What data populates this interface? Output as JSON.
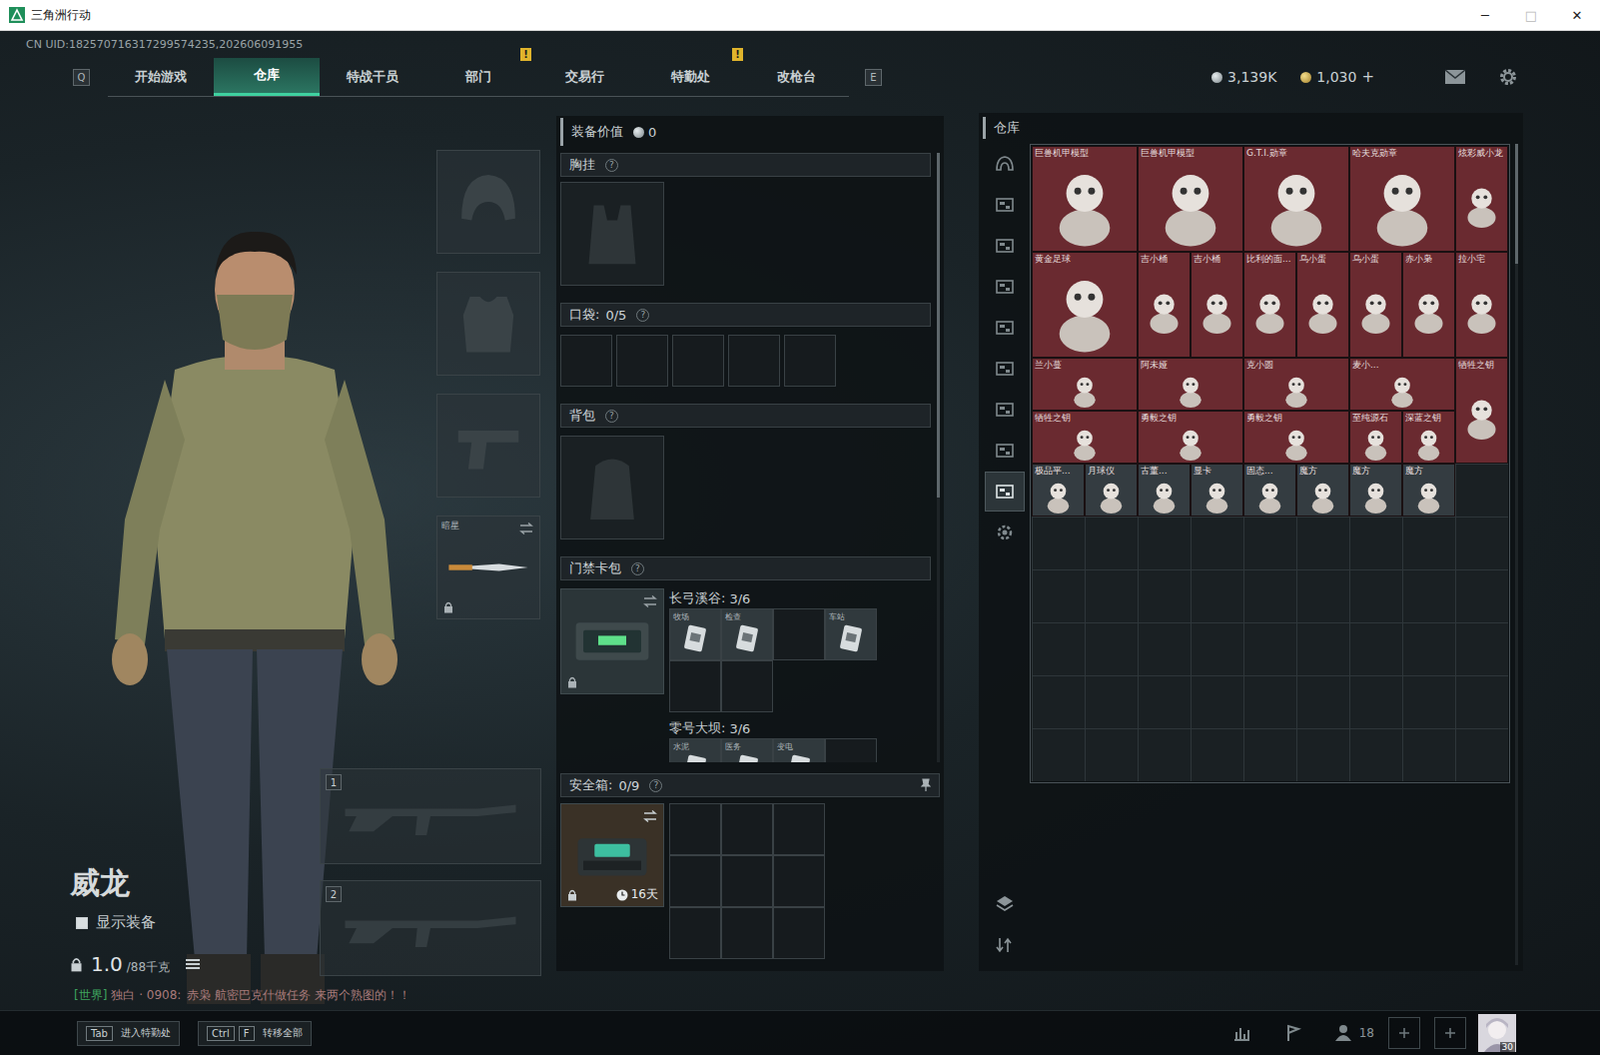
{
  "window": {
    "title": "三角洲行动",
    "controls": [
      {
        "glyph": "─",
        "disabled": false
      },
      {
        "glyph": "□",
        "disabled": true
      },
      {
        "glyph": "✕",
        "disabled": false
      }
    ]
  },
  "uid": "CN UID:182570716317299574235,202606091955",
  "nav": {
    "prev_key": "Q",
    "next_key": "E",
    "tabs": [
      {
        "label": "开始游戏",
        "selected": false,
        "badge": ""
      },
      {
        "label": "仓库",
        "selected": true,
        "badge": ""
      },
      {
        "label": "特战干员",
        "selected": false,
        "badge": ""
      },
      {
        "label": "部门",
        "selected": false,
        "badge": "!"
      },
      {
        "label": "交易行",
        "selected": false,
        "badge": ""
      },
      {
        "label": "特勤处",
        "selected": false,
        "badge": "!"
      },
      {
        "label": "改枪台",
        "selected": false,
        "badge": ""
      }
    ]
  },
  "currency": {
    "coins": "3,139K",
    "tickets": "1,030",
    "add": "+"
  },
  "operator": {
    "name": "威龙",
    "show_equipment": {
      "label": "显示装备",
      "checked": false
    },
    "weight": "1.0",
    "capacity": "/88千克"
  },
  "chat": {
    "channel": "[世界]",
    "sender": "独白 · 0908:",
    "message": "赤枭 航密巴克什做任务 来两个熟图的！！"
  },
  "equipment_slots": [
    {
      "kind": "helmet",
      "label": "",
      "locked": false,
      "swap": false
    },
    {
      "kind": "armor",
      "label": "",
      "locked": false,
      "swap": false
    },
    {
      "kind": "pistol",
      "label": "",
      "locked": false,
      "swap": false
    },
    {
      "kind": "melee",
      "label": "暗星",
      "locked": true,
      "swap": true
    }
  ],
  "weapon_slots": [
    {
      "number": "1"
    },
    {
      "number": "2"
    }
  ],
  "loadout": {
    "value_label": "装备价值",
    "value": "0",
    "chest_rig": {
      "title": "胸挂",
      "help": "?"
    },
    "pockets": {
      "title": "口袋:",
      "count": "0/5",
      "help": "?",
      "slots": [
        {
          "filled": false
        },
        {
          "filled": false
        },
        {
          "filled": false
        },
        {
          "filled": false
        },
        {
          "filled": false
        }
      ]
    },
    "backpack": {
      "title": "背包",
      "help": "?"
    },
    "keycard_case": {
      "title": "门禁卡包",
      "help": "?",
      "locked": true,
      "swap": true,
      "maps": [
        {
          "name": "长弓溪谷:",
          "count": "3/6",
          "cards": [
            {
              "label": "牧场",
              "filled": true
            },
            {
              "label": "检查",
              "filled": true
            },
            {
              "label": "",
              "filled": false
            },
            {
              "label": "车站",
              "filled": true
            },
            {
              "label": "",
              "filled": false
            },
            {
              "label": "",
              "filled": false
            }
          ]
        },
        {
          "name": "零号大坝:",
          "count": "3/6",
          "cards": [
            {
              "label": "水泥",
              "filled": true
            },
            {
              "label": "医务",
              "filled": true
            },
            {
              "label": "变电",
              "filled": true
            },
            {
              "label": "",
              "filled": false
            }
          ]
        }
      ]
    },
    "safe_box": {
      "title": "安全箱:",
      "count": "0/9",
      "help": "?",
      "duration": "16天",
      "locked": true,
      "swap": true,
      "slots": [
        {
          "filled": false
        },
        {
          "filled": false
        },
        {
          "filled": false
        },
        {
          "filled": false
        },
        {
          "filled": false
        },
        {
          "filled": false
        },
        {
          "filled": false
        },
        {
          "filled": false
        },
        {
          "filled": false
        }
      ]
    }
  },
  "warehouse": {
    "title": "仓库",
    "sidebar": [
      {
        "kind": "home",
        "selected": false
      },
      {
        "kind": "tab",
        "selected": false
      },
      {
        "kind": "tab",
        "selected": false
      },
      {
        "kind": "tab",
        "selected": false
      },
      {
        "kind": "tab",
        "selected": false
      },
      {
        "kind": "tab",
        "selected": false
      },
      {
        "kind": "tab",
        "selected": false
      },
      {
        "kind": "tab",
        "selected": false
      },
      {
        "kind": "tab",
        "selected": true
      },
      {
        "kind": "settings",
        "selected": false
      }
    ],
    "tools": [
      {
        "kind": "layers"
      },
      {
        "kind": "sort"
      }
    ],
    "items": [
      {
        "name": "巨兽机甲模型",
        "kind": "large",
        "color": "#6a2a30"
      },
      {
        "name": "巨兽机甲模型",
        "kind": "large",
        "color": "#6a2a30"
      },
      {
        "name": "G.T.I.勋章",
        "kind": "large",
        "color": "#6a2a30"
      },
      {
        "name": "哈夫克勋章",
        "kind": "large",
        "color": "#6a2a30"
      },
      {
        "name": "炫彩威小龙",
        "kind": "tall",
        "color": "#6a2a30"
      },
      {
        "name": "黄金足球",
        "kind": "large",
        "color": "#6a2a30"
      },
      {
        "name": "吉小桶",
        "kind": "tall",
        "color": "#6a2a30"
      },
      {
        "name": "吉小桶",
        "kind": "tall",
        "color": "#6a2a30"
      },
      {
        "name": "比利的面...",
        "kind": "tall",
        "color": "#6a2a30"
      },
      {
        "name": "乌小蛋",
        "kind": "tall",
        "color": "#6a2a30"
      },
      {
        "name": "乌小蛋",
        "kind": "tall",
        "color": "#6a2a30"
      },
      {
        "name": "赤小枭",
        "kind": "tall",
        "color": "#6a2a30"
      },
      {
        "name": "拉小宅",
        "kind": "tall",
        "color": "#6a2a30"
      },
      {
        "name": "兰小蔓",
        "kind": "wide",
        "color": "#6a2a30"
      },
      {
        "name": "阿未娅",
        "kind": "wide",
        "color": "#6a2a30"
      },
      {
        "name": "克小圆",
        "kind": "wide",
        "color": "#6a2a30"
      },
      {
        "name": "麦小...",
        "kind": "wide",
        "color": "#6a2a30"
      },
      {
        "name": "牺牲之钥",
        "kind": "tall",
        "color": "#6a2a30"
      },
      {
        "name": "牺牲之钥",
        "kind": "wide",
        "color": "#6a2a30"
      },
      {
        "name": "勇毅之钥",
        "kind": "wide",
        "color": "#6a2a30"
      },
      {
        "name": "勇毅之钥",
        "kind": "wide",
        "color": "#6a2a30"
      },
      {
        "name": "至纯源石",
        "kind": "small",
        "color": "#6a2a30"
      },
      {
        "name": "深蓝之钥",
        "kind": "small",
        "color": "#6a2a30"
      },
      {
        "name": "极品平...",
        "kind": "small",
        "color": "#343c41"
      },
      {
        "name": "月球仪",
        "kind": "small",
        "color": "#343c41"
      },
      {
        "name": "古董...",
        "kind": "small",
        "color": "#343c41"
      },
      {
        "name": "显卡",
        "kind": "small",
        "color": "#343c41"
      },
      {
        "name": "固态...",
        "kind": "small",
        "color": "#343c41"
      },
      {
        "name": "魔方",
        "kind": "small",
        "color": "#343c41"
      },
      {
        "name": "魔方",
        "kind": "small",
        "color": "#343c41"
      },
      {
        "name": "魔方",
        "kind": "small",
        "color": "#343c41"
      }
    ]
  },
  "bottom_bar": {
    "hints": [
      {
        "keys": [
          "Tab"
        ],
        "label": "进入特勤处"
      },
      {
        "keys": [
          "Ctrl",
          "F"
        ],
        "label": "转移全部"
      }
    ],
    "friends": "18",
    "level": "30"
  }
}
